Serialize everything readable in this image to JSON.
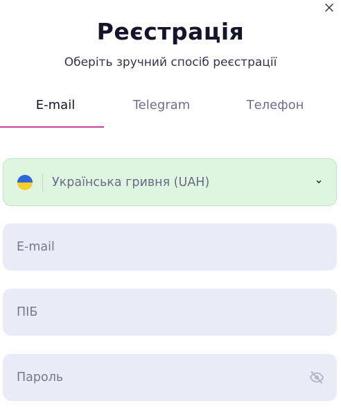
{
  "header": {
    "title": "Реєстрація",
    "subtitle": "Оберіть зручний спосіб реєстрації"
  },
  "tabs": [
    {
      "label": "E-mail",
      "active": true
    },
    {
      "label": "Telegram",
      "active": false
    },
    {
      "label": "Телефон",
      "active": false
    }
  ],
  "currency": {
    "selected": "Українська гривня (UAH)",
    "flag_icon": "ukraine-flag-icon"
  },
  "form": {
    "email_placeholder": "E-mail",
    "name_placeholder": "ПІБ",
    "password_placeholder": "Пароль"
  },
  "colors": {
    "accent": "#c2409a",
    "currency_bg": "#def5e0",
    "field_bg": "#e9ebf6"
  }
}
